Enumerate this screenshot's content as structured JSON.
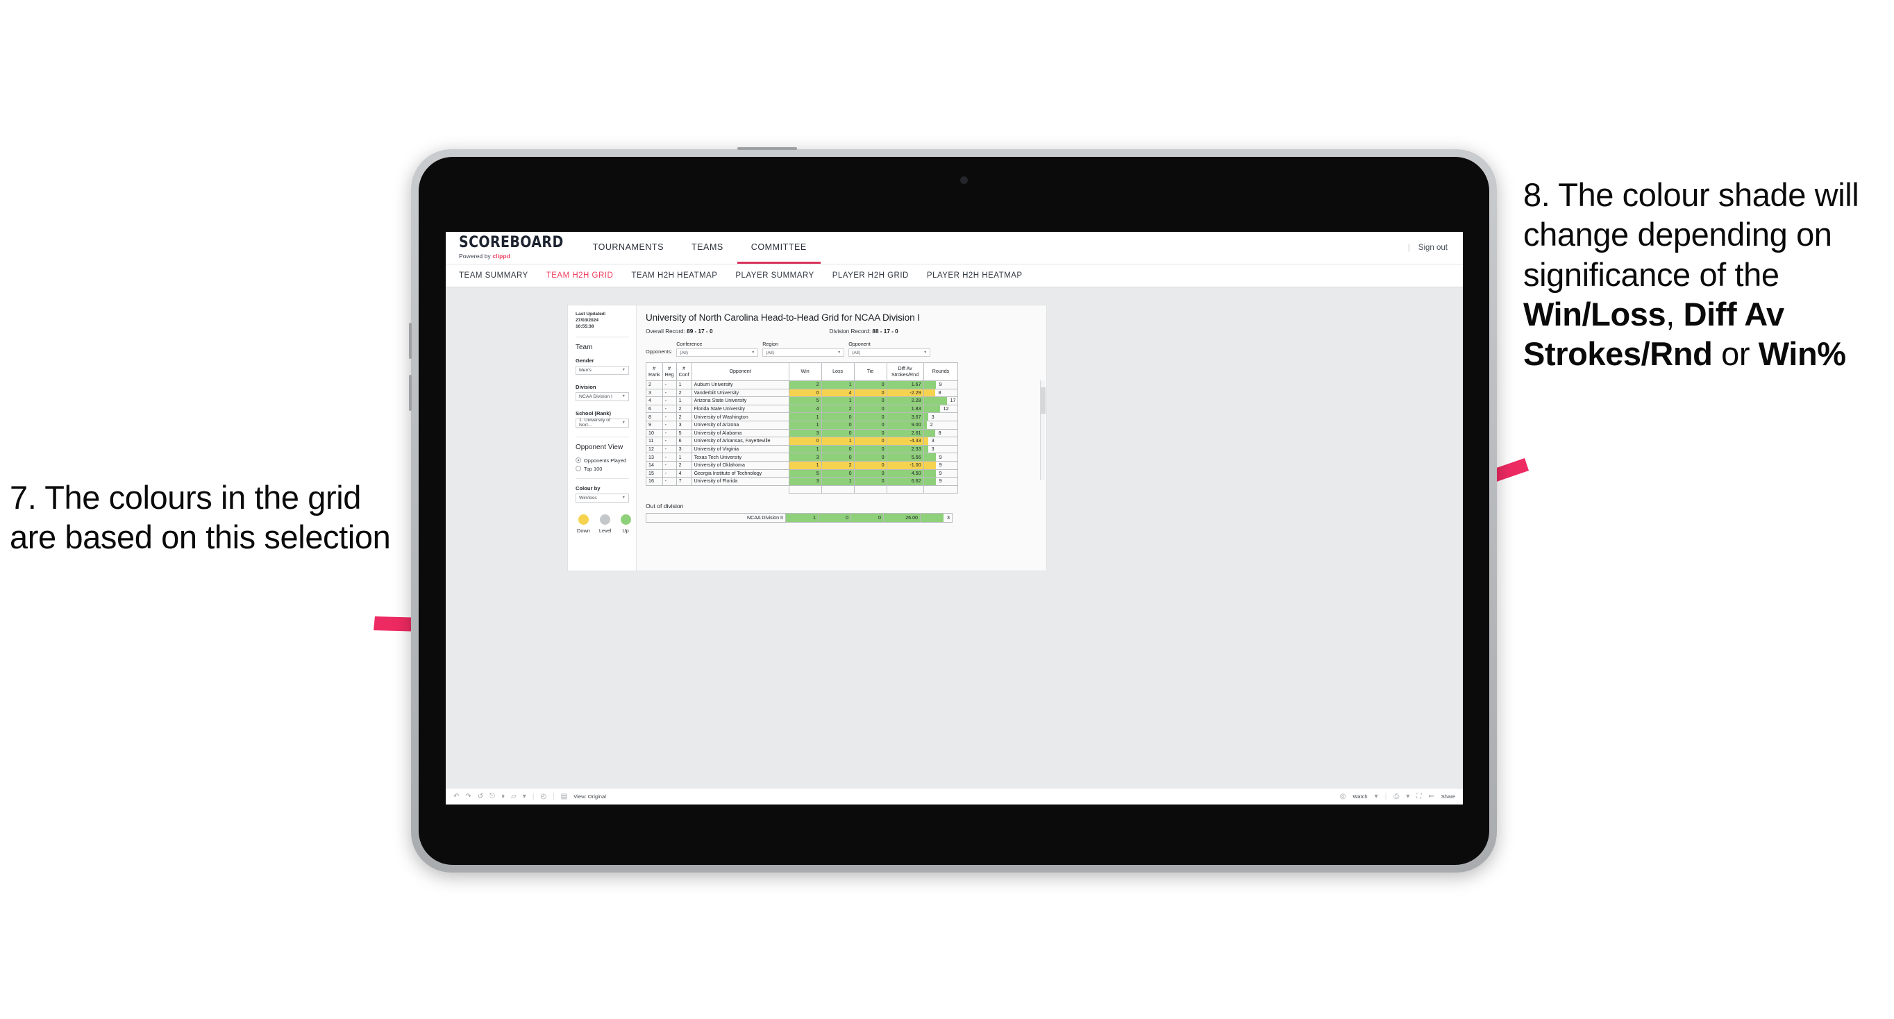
{
  "annotations": {
    "left": {
      "number": "7.",
      "text": "The colours in the grid are based on this selection"
    },
    "right": {
      "number": "8.",
      "text_parts": [
        {
          "t": "The colour shade will change depending on significance of the ",
          "bold": false
        },
        {
          "t": "Win/Loss",
          "bold": true
        },
        {
          "t": ", ",
          "bold": false
        },
        {
          "t": "Diff Av Strokes/Rnd",
          "bold": true
        },
        {
          "t": " or ",
          "bold": false
        },
        {
          "t": "Win%",
          "bold": true
        }
      ]
    },
    "arrow_color": "#ee2a62"
  },
  "app": {
    "brand": {
      "title": "SCOREBOARD",
      "powered_prefix": "Powered by ",
      "powered_name": "clippd"
    },
    "topnav": [
      {
        "label": "TOURNAMENTS",
        "active": false
      },
      {
        "label": "TEAMS",
        "active": false
      },
      {
        "label": "COMMITTEE",
        "active": true
      }
    ],
    "sign_out": "Sign out",
    "subnav": [
      {
        "label": "TEAM SUMMARY",
        "active": false
      },
      {
        "label": "TEAM H2H GRID",
        "active": true
      },
      {
        "label": "TEAM H2H HEATMAP",
        "active": false
      },
      {
        "label": "PLAYER SUMMARY",
        "active": false
      },
      {
        "label": "PLAYER H2H GRID",
        "active": false
      },
      {
        "label": "PLAYER H2H HEATMAP",
        "active": false
      }
    ]
  },
  "sidebar": {
    "last_updated_label": "Last Updated: 27/03/2024",
    "last_updated_time": "16:55:38",
    "team_heading": "Team",
    "gender_label": "Gender",
    "gender_value": "Men's",
    "division_label": "Division",
    "division_value": "NCAA Division I",
    "school_label": "School (Rank)",
    "school_value": "1. University of Nort...",
    "opponent_view_heading": "Opponent View",
    "opponent_view_options": [
      {
        "label": "Opponents Played",
        "selected": true
      },
      {
        "label": "Top 100",
        "selected": false
      }
    ],
    "colour_by_label": "Colour by",
    "colour_by_value": "Win/loss",
    "legend": [
      {
        "label": "Down",
        "color": "#f5d34f"
      },
      {
        "label": "Level",
        "color": "#c4c7ca"
      },
      {
        "label": "Up",
        "color": "#8fd07a"
      }
    ]
  },
  "viz": {
    "title": "University of North Carolina Head-to-Head Grid for NCAA Division I",
    "overall_record_label": "Overall Record:",
    "overall_record_value": "89 - 17 - 0",
    "division_record_label": "Division Record:",
    "division_record_value": "88 - 17 - 0",
    "opponents_label": "Opponents:",
    "filters": [
      {
        "label": "Conference",
        "value": "(All)"
      },
      {
        "label": "Region",
        "value": "(All)"
      },
      {
        "label": "Opponent",
        "value": "(All)"
      }
    ],
    "out_of_division_title": "Out of division"
  },
  "chart_data": {
    "type": "table",
    "title": "University of North Carolina Head-to-Head Grid for NCAA Division I",
    "columns": [
      "# Rank",
      "# Reg",
      "# Conf",
      "Opponent",
      "Win",
      "Loss",
      "Tie",
      "Diff Av Strokes/Rnd",
      "Rounds"
    ],
    "column_header_lines": [
      [
        "#",
        "Rank"
      ],
      [
        "#",
        "Reg"
      ],
      [
        "#",
        "Conf"
      ],
      [
        "Opponent"
      ],
      [
        "Win"
      ],
      [
        "Loss"
      ],
      [
        "Tie"
      ],
      [
        "Diff Av",
        "Strokes/Rnd"
      ],
      [
        "Rounds"
      ]
    ],
    "rounds_max": 17,
    "rows": [
      {
        "rank": "2",
        "reg": "-",
        "conf": "1",
        "opponent": "Auburn University",
        "win": "2",
        "loss": "1",
        "tie": "0",
        "diff": "1.67",
        "rounds": "9",
        "state": "up"
      },
      {
        "rank": "3",
        "reg": "-",
        "conf": "2",
        "opponent": "Vanderbilt University",
        "win": "0",
        "loss": "4",
        "tie": "0",
        "diff": "-2.29",
        "rounds": "8",
        "state": "down"
      },
      {
        "rank": "4",
        "reg": "-",
        "conf": "1",
        "opponent": "Arizona State University",
        "win": "5",
        "loss": "1",
        "tie": "0",
        "diff": "2.28",
        "rounds": "17",
        "state": "up"
      },
      {
        "rank": "6",
        "reg": "-",
        "conf": "2",
        "opponent": "Florida State University",
        "win": "4",
        "loss": "2",
        "tie": "0",
        "diff": "1.83",
        "rounds": "12",
        "state": "up"
      },
      {
        "rank": "8",
        "reg": "-",
        "conf": "2",
        "opponent": "University of Washington",
        "win": "1",
        "loss": "0",
        "tie": "0",
        "diff": "3.67",
        "rounds": "3",
        "state": "up"
      },
      {
        "rank": "9",
        "reg": "-",
        "conf": "3",
        "opponent": "University of Arizona",
        "win": "1",
        "loss": "0",
        "tie": "0",
        "diff": "9.00",
        "rounds": "2",
        "state": "up"
      },
      {
        "rank": "10",
        "reg": "-",
        "conf": "5",
        "opponent": "University of Alabama",
        "win": "3",
        "loss": "0",
        "tie": "0",
        "diff": "2.61",
        "rounds": "8",
        "state": "up"
      },
      {
        "rank": "11",
        "reg": "-",
        "conf": "6",
        "opponent": "University of Arkansas, Fayetteville",
        "win": "0",
        "loss": "1",
        "tie": "0",
        "diff": "-4.33",
        "rounds": "3",
        "state": "down"
      },
      {
        "rank": "12",
        "reg": "-",
        "conf": "3",
        "opponent": "University of Virginia",
        "win": "1",
        "loss": "0",
        "tie": "0",
        "diff": "2.33",
        "rounds": "3",
        "state": "up"
      },
      {
        "rank": "13",
        "reg": "-",
        "conf": "1",
        "opponent": "Texas Tech University",
        "win": "3",
        "loss": "0",
        "tie": "0",
        "diff": "5.56",
        "rounds": "9",
        "state": "up"
      },
      {
        "rank": "14",
        "reg": "-",
        "conf": "2",
        "opponent": "University of Oklahoma",
        "win": "1",
        "loss": "2",
        "tie": "0",
        "diff": "-1.00",
        "rounds": "9",
        "state": "down"
      },
      {
        "rank": "15",
        "reg": "-",
        "conf": "4",
        "opponent": "Georgia Institute of Technology",
        "win": "5",
        "loss": "0",
        "tie": "0",
        "diff": "4.50",
        "rounds": "9",
        "state": "up"
      },
      {
        "rank": "16",
        "reg": "-",
        "conf": "7",
        "opponent": "University of Florida",
        "win": "3",
        "loss": "1",
        "tie": "0",
        "diff": "6.62",
        "rounds": "9",
        "state": "up"
      }
    ],
    "out_of_division_row": {
      "opponent": "NCAA Division II",
      "win": "1",
      "loss": "0",
      "tie": "0",
      "diff": "26.00",
      "rounds": "3",
      "state": "up"
    }
  },
  "toolbar": {
    "view_label": "View: Original",
    "watch_label": "Watch",
    "share_label": "Share"
  }
}
